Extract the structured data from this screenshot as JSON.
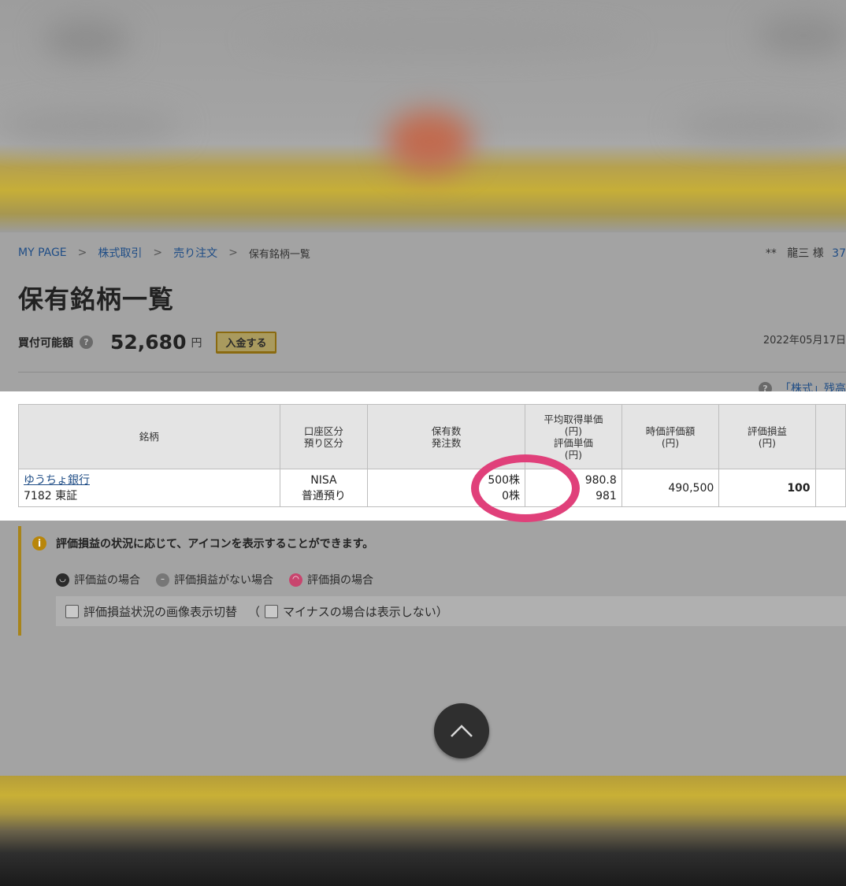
{
  "breadcrumb": {
    "items": [
      "MY PAGE",
      "株式取引",
      "売り注文"
    ],
    "separator": ">",
    "current": "保有銘柄一覧"
  },
  "user": {
    "prefix": "**",
    "name": "龍三 様",
    "amount_partial": "37"
  },
  "page_title": "保有銘柄一覧",
  "buying_power": {
    "label": "買付可能額",
    "amount": "52,680",
    "unit": "円",
    "deposit_button": "入金する"
  },
  "date_partial": "2022年05月17日",
  "help_link": "「株式」残高",
  "table": {
    "headers": {
      "name": "銘柄",
      "account_line1": "口座区分",
      "account_line2": "預り区分",
      "qty_line1": "保有数",
      "qty_line2": "発注数",
      "avg_line1": "平均取得単価",
      "avg_line2": "(円)",
      "avg_line3": "評価単価",
      "avg_line4": "(円)",
      "market_line1": "時価評価額",
      "market_line2": "(円)",
      "pl_line1": "評価損益",
      "pl_line2": "(円)"
    },
    "rows": [
      {
        "name": "ゆうちょ銀行",
        "code_market": "7182 東証",
        "account": "NISA",
        "deposit_type": "普通預り",
        "holding": "500株",
        "ordered": "0株",
        "avg_cost": "980.8",
        "eval_price": "981",
        "market_value": "490,500",
        "pl": "100"
      }
    ]
  },
  "info": {
    "title": "評価損益の状況に応じて、アイコンを表示することができます。",
    "legend": [
      "評価益の場合",
      "評価損益がない場合",
      "評価損の場合"
    ],
    "toggle_label": "評価損益状況の画像表示切替",
    "paren_open": "（",
    "minus_label": "マイナスの場合は表示しない）"
  },
  "colors": {
    "link": "#1f4d86",
    "annotation": "#e0407a",
    "accent": "#a8841a"
  }
}
